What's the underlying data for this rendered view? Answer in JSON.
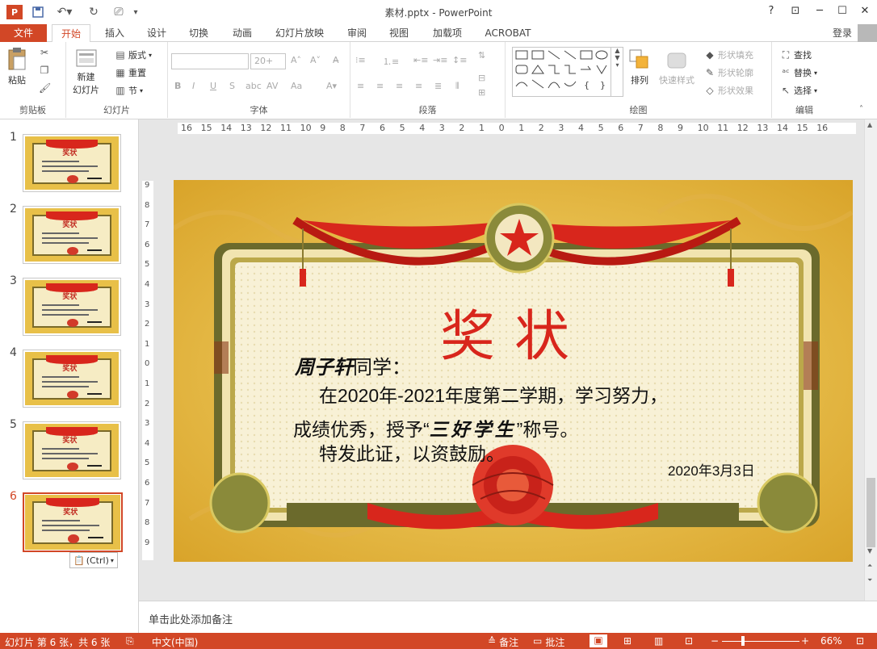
{
  "app": {
    "title": "素材.pptx - PowerPoint",
    "login": "登录",
    "help": "?"
  },
  "tabs": {
    "file": "文件",
    "home": "开始",
    "insert": "插入",
    "design": "设计",
    "transitions": "切换",
    "animations": "动画",
    "slideshow": "幻灯片放映",
    "review": "审阅",
    "view": "视图",
    "addins": "加载项",
    "acrobat": "ACROBAT"
  },
  "ribbon": {
    "clipboard": {
      "label": "剪贴板",
      "paste": "粘贴"
    },
    "slides": {
      "label": "幻灯片",
      "new_slide": "新建",
      "new_slide2": "幻灯片",
      "layout": "版式",
      "reset": "重置",
      "section": "节"
    },
    "font": {
      "label": "字体",
      "size": "20+"
    },
    "paragraph": {
      "label": "段落"
    },
    "drawing": {
      "label": "绘图",
      "arrange": "排列",
      "quick_styles": "快速样式",
      "shape_fill": "形状填充",
      "shape_outline": "形状轮廓",
      "shape_effects": "形状效果"
    },
    "editing": {
      "label": "编辑",
      "find": "查找",
      "replace": "替换",
      "select": "选择"
    }
  },
  "thumbnails": {
    "numbers": [
      "1",
      "2",
      "3",
      "4",
      "5",
      "6"
    ],
    "title": "奖状",
    "selected": "6",
    "paste_tag": "(Ctrl)"
  },
  "ruler": {
    "h": [
      "16",
      "15",
      "14",
      "13",
      "12",
      "11",
      "10",
      "9",
      "8",
      "7",
      "6",
      "5",
      "4",
      "3",
      "2",
      "1",
      "0",
      "1",
      "2",
      "3",
      "4",
      "5",
      "6",
      "7",
      "8",
      "9",
      "10",
      "11",
      "12",
      "13",
      "14",
      "15",
      "16"
    ],
    "v": [
      "9",
      "8",
      "7",
      "6",
      "5",
      "4",
      "3",
      "2",
      "1",
      "0",
      "1",
      "2",
      "3",
      "4",
      "5",
      "6",
      "7",
      "8",
      "9"
    ]
  },
  "slide": {
    "title": "奖状",
    "recipient": "周子轩",
    "greeting": "同学：",
    "line1": "在2020年-2021年度第二学期，学习努力，",
    "line2a": "成绩优秀，授予“",
    "award": "三好学生",
    "line2b": "”称号。",
    "line3": "特发此证，以资鼓励。",
    "date": "2020年3月3日"
  },
  "notes": {
    "placeholder": "单击此处添加备注"
  },
  "status": {
    "slide_info": "幻灯片 第 6 张，共 6 张",
    "language": "中文(中国)",
    "notes": "备注",
    "comments": "批注",
    "zoom": "66%"
  },
  "colors": {
    "accent": "#d24726",
    "gold": "#e9b938",
    "red": "#d8261c"
  }
}
